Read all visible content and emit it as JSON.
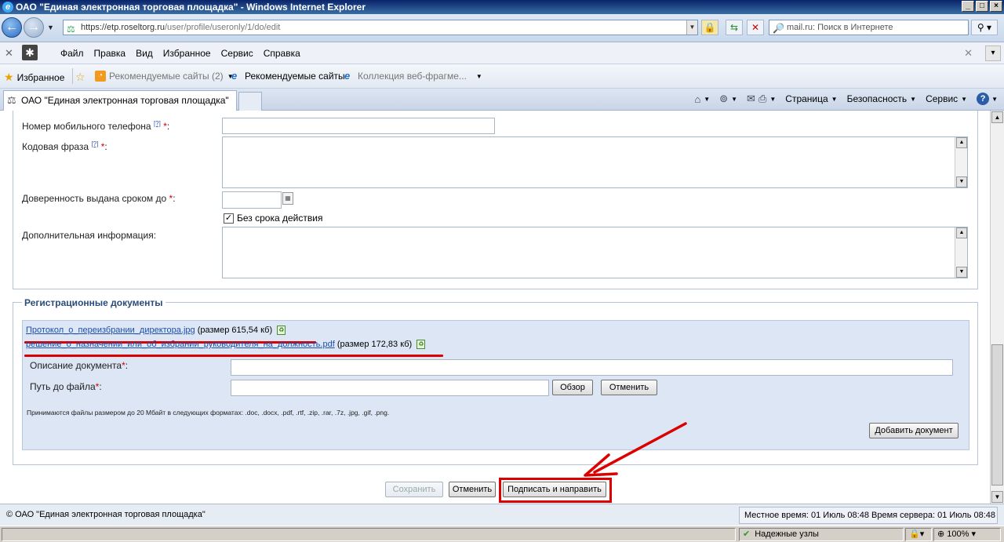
{
  "window": {
    "title": "ОАО \"Единая электронная торговая площадка\" - Windows Internet Explorer"
  },
  "address": {
    "url_host": "https://etp.roseltorg.ru",
    "url_path": "/user/profile/useronly/1/do/edit",
    "search_placeholder": "mail.ru: Поиск в Интернете"
  },
  "menu": {
    "items": [
      "Файл",
      "Правка",
      "Вид",
      "Избранное",
      "Сервис",
      "Справка"
    ]
  },
  "favorites": {
    "label": "Избранное",
    "recommended_dropdown": "Рекомендуемые сайты (2)",
    "recommended": "Рекомендуемые сайты",
    "webslice": "Коллекция веб-фрагме..."
  },
  "tabs": {
    "active": "ОАО \"Единая электронная торговая площадка\""
  },
  "commandbar": {
    "page": "Страница",
    "security": "Безопасность",
    "tools": "Сервис"
  },
  "form": {
    "mobile_label": "Номер мобильного телефона",
    "codephrase_label": "Кодовая фраза",
    "hint_mark": "[?]",
    "req_mark": "*",
    "colon": ":",
    "proxy_label": "Доверенность выдана сроком до",
    "no_expiry_label": "Без срока действия",
    "no_expiry_checked": true,
    "extra_label": "Дополнительная информация:"
  },
  "docs": {
    "title": "Регистрационные документы",
    "files": [
      {
        "name": "Протокол_о_переизбрании_директора.jpg",
        "size": "(размер 615,54 кб)"
      },
      {
        "name": "решение_о_назначении_или_об_избрании_руководителя_на_должность.pdf",
        "size": "(размер 172,83 кб)"
      }
    ],
    "description_label": "Описание документа",
    "path_label": "Путь до файла",
    "browse_button": "Обзор",
    "cancel_button": "Отменить",
    "note": "Принимаются файлы размером до 20 Мбайт в следующих форматах: .doc, .docx, .pdf, .rtf, .zip, .rar, .7z, .jpg, .gif, .png.",
    "add_button": "Добавить документ"
  },
  "actions": {
    "save": "Сохранить",
    "cancel": "Отменить",
    "sign_send": "Подписать и направить"
  },
  "footer": {
    "copyright": "© ОАО \"Единая электронная торговая площадка\"",
    "time": "Местное время: 01 Июль 08:48 Время сервера: 01 Июль 08:48"
  },
  "status": {
    "zone": "Надежные узлы",
    "zoom": "100%"
  },
  "colors": {
    "annotation_red": "#dd0000",
    "link": "#1f4fa8"
  }
}
